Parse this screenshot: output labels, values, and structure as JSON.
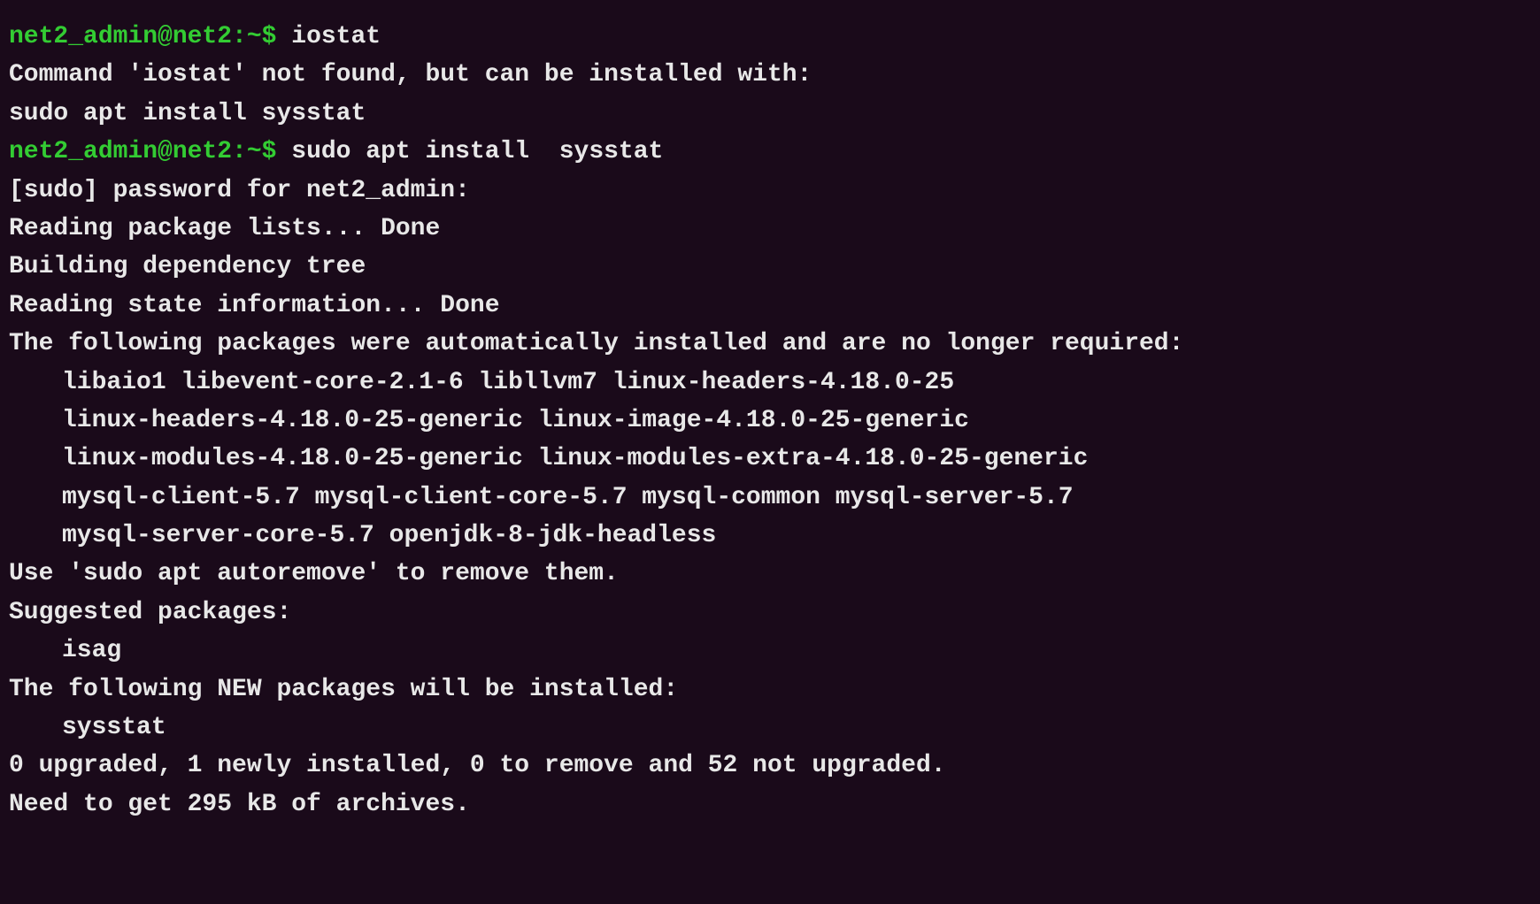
{
  "terminal": {
    "lines": [
      {
        "id": "prompt-iostat",
        "type": "prompt",
        "prompt": "net2_admin@net2:~$ ",
        "command": "iostat"
      },
      {
        "id": "blank1",
        "type": "blank"
      },
      {
        "id": "not-found",
        "type": "text",
        "text": "Command 'iostat' not found, but can be installed with:"
      },
      {
        "id": "blank2",
        "type": "blank"
      },
      {
        "id": "sudo-install-suggest",
        "type": "text",
        "text": "sudo apt install sysstat"
      },
      {
        "id": "blank3",
        "type": "blank"
      },
      {
        "id": "prompt-sudo",
        "type": "prompt",
        "prompt": "net2_admin@net2:~$ ",
        "command": "sudo apt install  sysstat"
      },
      {
        "id": "sudo-password",
        "type": "text",
        "text": "[sudo] password for net2_admin:"
      },
      {
        "id": "reading-pkg",
        "type": "text",
        "text": "Reading package lists... Done"
      },
      {
        "id": "building-dep",
        "type": "text",
        "text": "Building dependency tree"
      },
      {
        "id": "reading-state",
        "type": "text",
        "text": "Reading state information... Done"
      },
      {
        "id": "auto-installed",
        "type": "text",
        "text": "The following packages were automatically installed and are no longer required:"
      },
      {
        "id": "pkg1",
        "type": "text-indent",
        "text": "libaio1 libevent-core-2.1-6 libllvm7 linux-headers-4.18.0-25"
      },
      {
        "id": "pkg2",
        "type": "text-indent",
        "text": "linux-headers-4.18.0-25-generic linux-image-4.18.0-25-generic"
      },
      {
        "id": "pkg3",
        "type": "text-indent",
        "text": "linux-modules-4.18.0-25-generic linux-modules-extra-4.18.0-25-generic"
      },
      {
        "id": "pkg4",
        "type": "text-indent",
        "text": "mysql-client-5.7 mysql-client-core-5.7 mysql-common mysql-server-5.7"
      },
      {
        "id": "pkg5",
        "type": "text-indent",
        "text": "mysql-server-core-5.7 openjdk-8-jdk-headless"
      },
      {
        "id": "autoremove",
        "type": "text",
        "text": "Use 'sudo apt autoremove' to remove them."
      },
      {
        "id": "suggested",
        "type": "text",
        "text": "Suggested packages:"
      },
      {
        "id": "isag",
        "type": "text-indent",
        "text": "isag"
      },
      {
        "id": "new-packages",
        "type": "text",
        "text": "The following NEW packages will be installed:"
      },
      {
        "id": "sysstat",
        "type": "text-indent",
        "text": "sysstat"
      },
      {
        "id": "upgrade-summary",
        "type": "text",
        "text": "0 upgraded, 1 newly installed, 0 to remove and 52 not upgraded."
      },
      {
        "id": "need-to-get",
        "type": "text",
        "text": "Need to get 295 kB of archives."
      }
    ]
  }
}
